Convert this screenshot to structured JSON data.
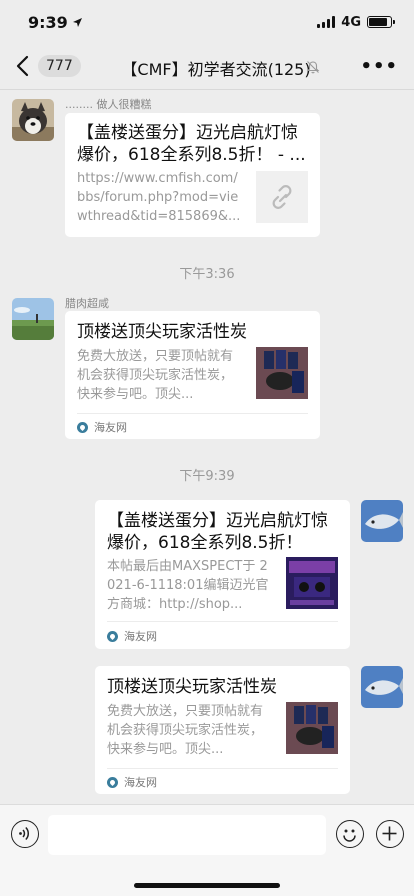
{
  "status_bar": {
    "time": "9:39",
    "network": "4G",
    "battery_level": 0.85
  },
  "nav": {
    "unread_count": "777",
    "title": "【CMF】初学者交流(125)",
    "more": "•••"
  },
  "messages": [
    {
      "sender": "........ 做人很糟糕",
      "title": "【盖楼送蛋分】迈光启航灯惊爆价，618全系列8.5折！ - ...",
      "description": "https://www.cmfish.com/bbs/forum.php?mod=viewthread&tid=815869&...",
      "thumb_icon": "link-icon"
    },
    {
      "timestamp": "下午3:36"
    },
    {
      "sender": "腊肉超咸",
      "title": "顶楼送顶尖玩家活性炭",
      "description": "免费大放送，只要顶帖就有机会获得顶尖玩家活性炭，快来参与吧。顶尖...",
      "source": "海友网"
    },
    {
      "timestamp": "下午9:39"
    },
    {
      "title": "【盖楼送蛋分】迈光启航灯惊爆价，618全系列8.5折！",
      "description": "本帖最后由MAXSPECT于 2021-6-1118:01编辑迈光官方商城：http://shop...",
      "source": "海友网"
    },
    {
      "title": "顶楼送顶尖玩家活性炭",
      "description": "免费大放送，只要顶帖就有机会获得顶尖玩家活性炭，快来参与吧。顶尖...",
      "source": "海友网"
    }
  ]
}
